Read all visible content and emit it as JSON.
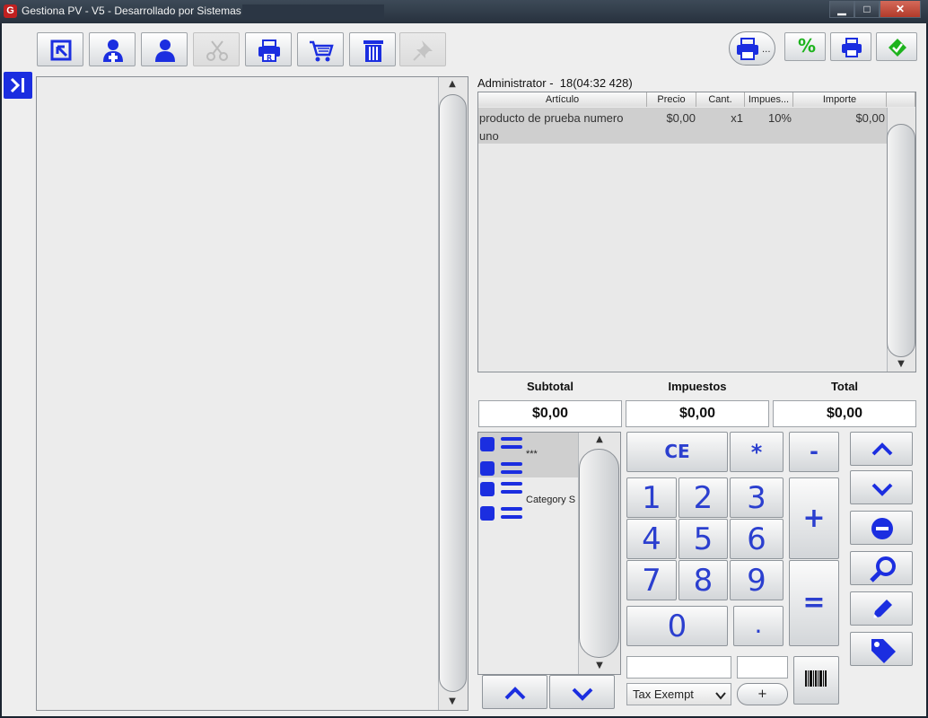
{
  "window": {
    "title": "Gestiona PV - V5 - Desarrollado por Sistemas",
    "icon_letter": "G",
    "minimize": "▁",
    "maximize": "□",
    "close": "✕"
  },
  "toolbar": {
    "icons": [
      "export-icon",
      "add-customer-icon",
      "customer-icon",
      "scissors-icon",
      "print-receipt-icon",
      "shopping-cart-icon",
      "trash-icon",
      "pin-icon"
    ],
    "right_icons": [
      "printer-menu-icon",
      "discount-icon",
      "printer-icon",
      "confirm-icon"
    ],
    "discount_symbol": "%",
    "more_dots": "..."
  },
  "ticket": {
    "header": "Administrator -  18(04:32 428)",
    "columns": [
      "Artículo",
      "Precio",
      "Cant.",
      "Impues...",
      "Importe"
    ],
    "rows": [
      {
        "articulo_line1": "producto de prueba numero",
        "articulo_line2": "uno",
        "precio": "$0,00",
        "cant": "x1",
        "impuesto": "10%",
        "importe": "$0,00"
      }
    ]
  },
  "totals": {
    "subtotal_label": "Subtotal",
    "subtotal_value": "$0,00",
    "impuestos_label": "Impuestos",
    "impuestos_value": "$0,00",
    "total_label": "Total",
    "total_value": "$0,00"
  },
  "categories": [
    {
      "label": "***"
    },
    {
      "label": "Category S"
    }
  ],
  "keypad": {
    "ce": "CE",
    "multiply": "*",
    "minus": "-",
    "plus": "+",
    "equals": "=",
    "digits": [
      "1",
      "2",
      "3",
      "4",
      "5",
      "6",
      "7",
      "8",
      "9",
      "0"
    ],
    "dot": "."
  },
  "bottom": {
    "tax_select": "Tax Exempt",
    "tax_add": "+",
    "barcode_icon": "barcode-icon"
  },
  "colors": {
    "accent": "#1b2ee0"
  }
}
